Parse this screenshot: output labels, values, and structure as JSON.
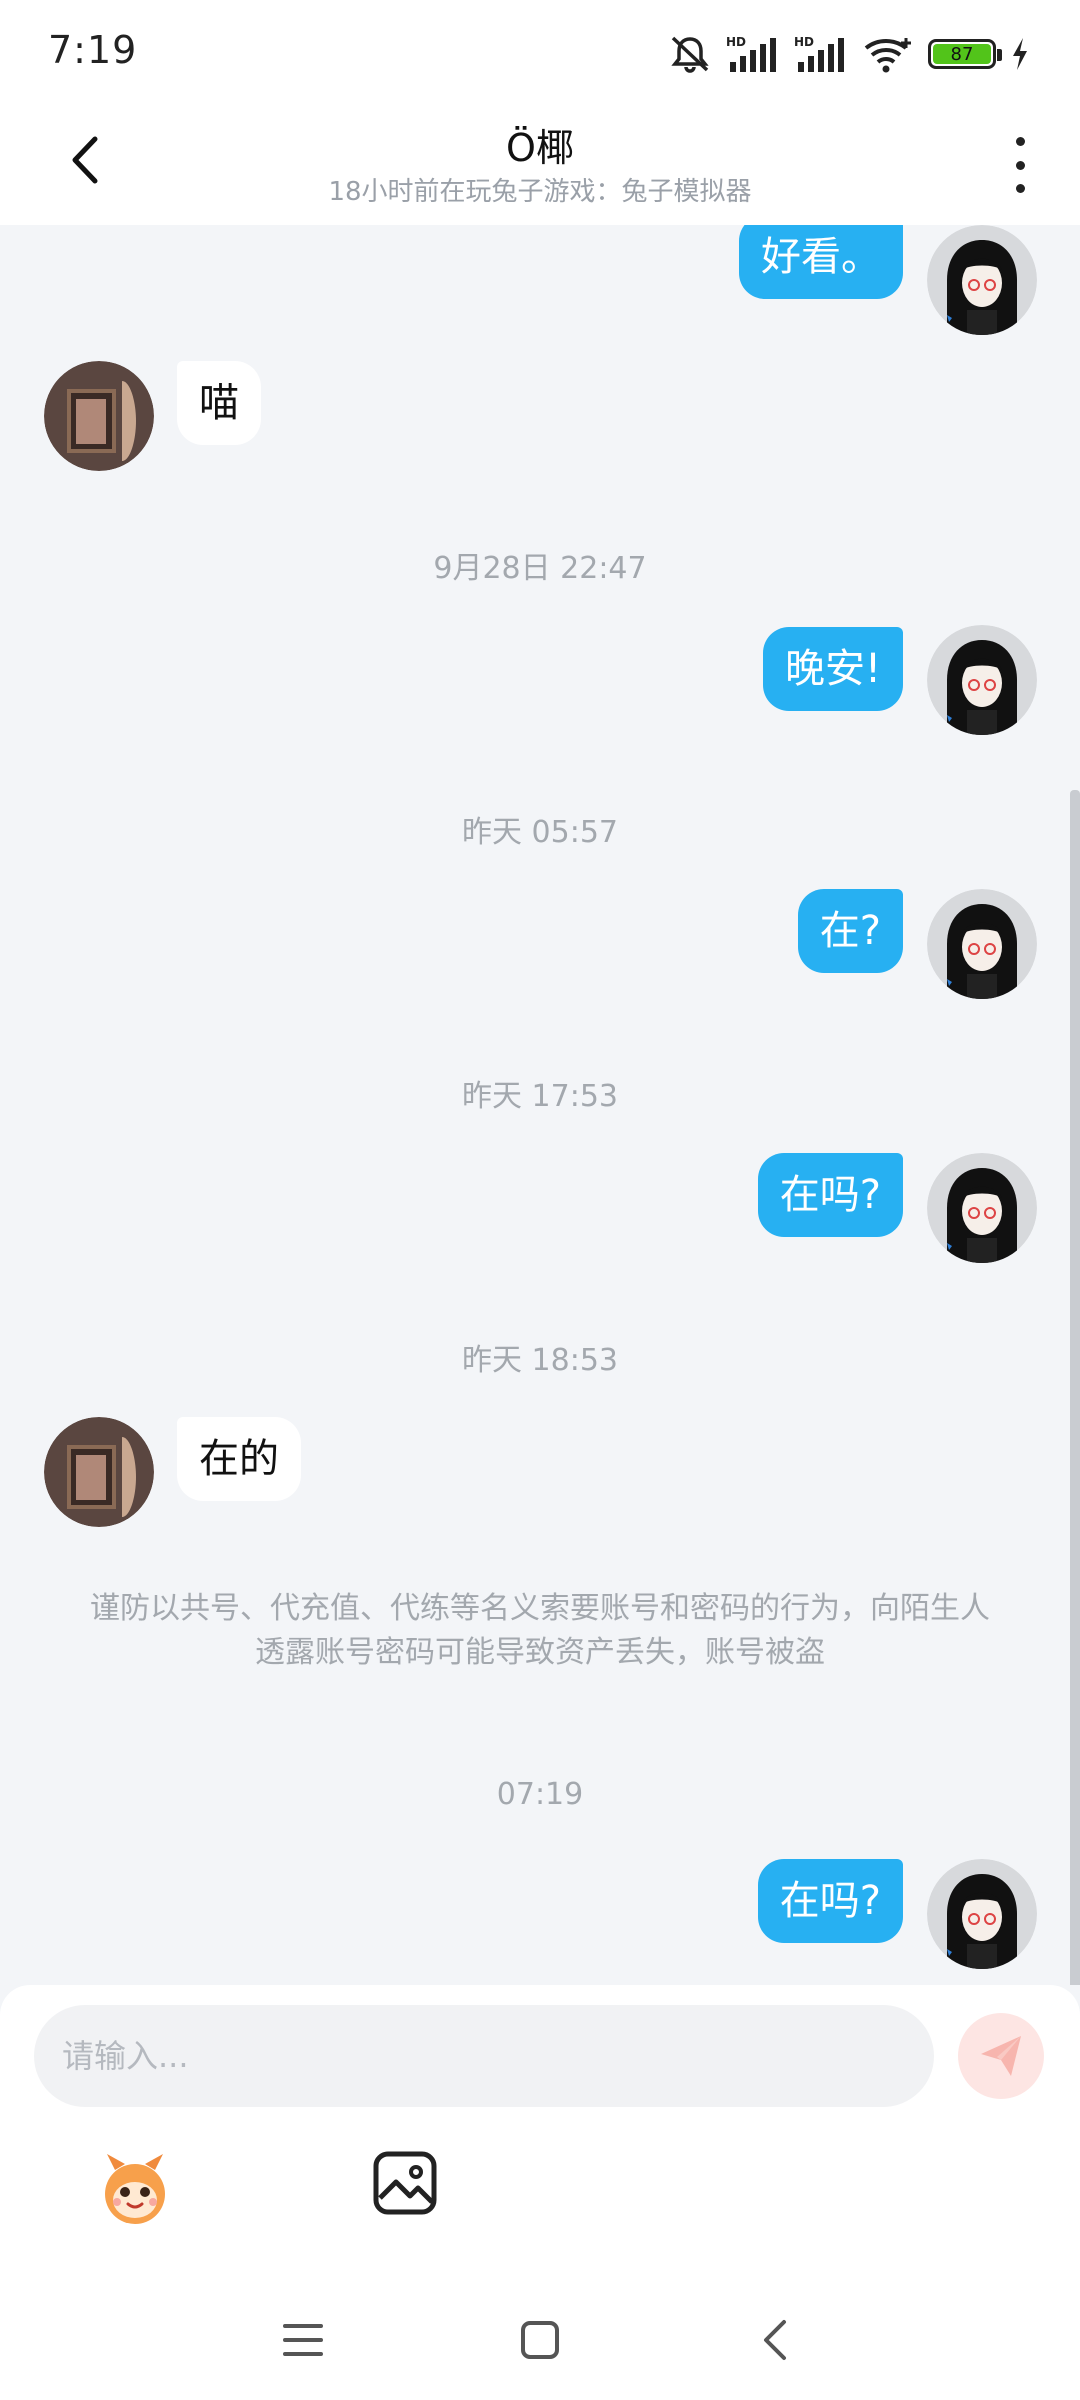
{
  "status_bar": {
    "time": "7:19",
    "battery_level": "87",
    "icons": [
      "mute-bell-icon",
      "hd-signal-icon",
      "hd-signal-icon",
      "wifi-icon",
      "battery-icon",
      "charging-icon"
    ]
  },
  "header": {
    "title": "Ö椰",
    "subtitle": "18小时前在玩兔子游戏：兔子模拟器"
  },
  "messages": [
    {
      "from": "me",
      "text": "好看。"
    },
    {
      "from": "them",
      "text": "喵"
    },
    {
      "type": "time",
      "text": "9月28日 22:47"
    },
    {
      "from": "me",
      "text": "晚安!"
    },
    {
      "type": "time",
      "text": "昨天 05:57"
    },
    {
      "from": "me",
      "text": "在?"
    },
    {
      "type": "time",
      "text": "昨天 17:53"
    },
    {
      "from": "me",
      "text": "在吗?"
    },
    {
      "type": "time",
      "text": "昨天 18:53"
    },
    {
      "from": "them",
      "text": "在的"
    },
    {
      "type": "notice",
      "text": "谨防以共号、代充值、代练等名义索要账号和密码的行为，向陌生人透露账号密码可能导致资产丢失，账号被盗"
    },
    {
      "type": "time",
      "text": "07:19"
    },
    {
      "from": "me",
      "text": "在吗?"
    }
  ],
  "composer": {
    "placeholder": "请输入...",
    "send_color": "#fde5e3"
  },
  "colors": {
    "my_bubble": "#27b0f2",
    "their_bubble": "#ffffff",
    "background": "#f3f5f8"
  }
}
